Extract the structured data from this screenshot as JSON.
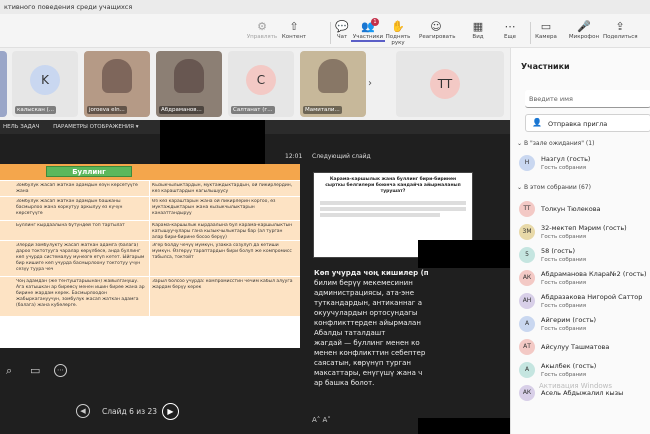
{
  "window": {
    "title": "ктивного поведения среди учащихся"
  },
  "toolbar": {
    "items": [
      {
        "label": "Управлять",
        "icon": "manage-icon",
        "glyph": "⚙",
        "disabled": true
      },
      {
        "label": "Контент",
        "icon": "share-icon",
        "glyph": "⇧",
        "disabled": false
      },
      {
        "label": "Чат",
        "icon": "chat-icon",
        "glyph": "💬",
        "disabled": false
      },
      {
        "label": "Участники",
        "icon": "people-icon",
        "glyph": "👥",
        "disabled": false,
        "badge": "1"
      },
      {
        "label": "Поднять руку",
        "icon": "raise-hand-icon",
        "glyph": "✋",
        "disabled": false
      },
      {
        "label": "Реагировать",
        "icon": "react-icon",
        "glyph": "☺",
        "disabled": false
      },
      {
        "label": "Вид",
        "icon": "view-icon",
        "glyph": "▦",
        "disabled": false
      },
      {
        "label": "Еще",
        "icon": "more-icon",
        "glyph": "⋯",
        "disabled": false
      },
      {
        "label": "Камера",
        "icon": "camera-icon",
        "glyph": "▭",
        "disabled": false
      },
      {
        "label": "Микрофон",
        "icon": "mic-icon",
        "glyph": "🎤",
        "disabled": false
      },
      {
        "label": "Поделиться",
        "icon": "share-screen-icon",
        "glyph": "⇪",
        "disabled": false
      }
    ]
  },
  "thumbs": [
    {
      "name": "калыскан (...",
      "initials": "K",
      "bg": "#c9d7f0",
      "kind": "avatar"
    },
    {
      "name": "joroeva eln...",
      "initials": "",
      "bg": "#b59a86",
      "kind": "video"
    },
    {
      "name": "Абдраманов...",
      "initials": "",
      "bg": "#8c7f74",
      "kind": "video"
    },
    {
      "name": "Салтанат (г...",
      "initials": "С",
      "bg": "#f3c9c5",
      "kind": "avatar"
    },
    {
      "name": "Мамитали...",
      "initials": "",
      "bg": "#c7b89a",
      "kind": "video"
    },
    {
      "name": "",
      "initials": "TT",
      "bg": "#f3c9c5",
      "kind": "big"
    }
  ],
  "presenter": {
    "bar_left": "НЕЛЬ ЗАДАЧ",
    "bar_display": "ПАРАМЕТРЫ ОТОБРАЖЕНИЯ ▾",
    "time": "12:01",
    "next_slide": "Следующий слайд",
    "slide_counter": "Слайд 6 из 23",
    "next_title": "Карама-каршылык жана буллинг бири-биринен сырткы белгилери боюнча кандайча айырмаланып турушат?",
    "notes": [
      "Көп учурда чоң кишилер (п",
      "билим берүү мекемесинин",
      "администрациясы, ата-эне",
      "туткандардын, антиканнаг а",
      "окуучулардын ортосундагы",
      "конфликттерден айырмалан",
      "Абалды таталдашт",
      "жагдай — буллинг менен ко",
      "менен конфликттин себептер",
      "саясатын, көрүнүп турган",
      "максаттары, енүгүшү жана ч",
      "ар башка болот."
    ]
  },
  "slide": {
    "header": "Буллинг",
    "rows": [
      {
        "left": "Зомбулук жасап жаткан адамдын өзүн көрсөтүүгө жана",
        "right": "Кызыкчылыктардын, муктаждыктардын, ой пикирлердин, көз караштардын кагылышуусу"
      },
      {
        "left": "Зомбулук жасап жаткан адамдын башканы басмырлоо жана коркутуу аркылуу өз күчүн көрсөтүүгө",
        "right": "Өз көз караштарын жана ой пикирлерин коргоо, өз муктаждыктарын жана кызыкчылыктарын канааттандыруу"
      },
      {
        "left": "Буллинг кырдаалына бүтүндөй топ тартылат",
        "right": "Карама-каршылык кырдаалына бул карама-каршылыктын катышуучулары гана кызыкчылыктары бар (ал турган алар бири-бирине босоо берүү)"
      },
      {
        "left": "Элерди зомбулукту жасап жаткан адамга (балага) дароо токтотууга чаралар көрүлбөсө, анда буллинг көп учурда системалуу мүнөзгө өтүп кетет. Ыйгарым бир кишиге көп учурда басмырлоону токтотуу үчүн сезүү туура чеч",
        "right": "Эгер болду чечүү мүмкүн, узакка созулуп да кетиши мүмкүн. Өзгөрүү тараптардын бири болуп же компромисс табылса, токтойт"
      },
      {
        "left": "Чоң адамдан (же тентуштарыынан) жайылганушу. Ага катышкан ар бирөөсү менен ишин бирөө жана ар бирине жардам керек. Басмырлоодон жабыркагануучун, зомбулук жасап жаткан адамга (балага) жана кубөлөргө.",
        "right": "Зарыл болсоо учурда: компромисстин чечим кабыл алууга жардам берүү керек"
      }
    ]
  },
  "panel": {
    "title": "Участники",
    "search_placeholder": "Введите имя",
    "invite": "Отправка пригла",
    "lobby_header": "В \"зале ожидания\" (1)",
    "in_meeting_header": "В этом собрании (67)",
    "lobby": [
      {
        "name": "Назгул (гость)",
        "sub": "Гость собрания",
        "initials": "Н",
        "bg": "#c9d7f0"
      }
    ],
    "people": [
      {
        "name": "Толкун Тюлекова",
        "sub": "",
        "initials": "TT",
        "bg": "#f3c9c5"
      },
      {
        "name": "32-мектеп Мэрим (гость)",
        "sub": "Гость собрания",
        "initials": "3М",
        "bg": "#e8d9a8"
      },
      {
        "name": "58 (гость)",
        "sub": "Гость собрания",
        "initials": "5",
        "bg": "#c5e5e0"
      },
      {
        "name": "Абдраманова Клара№2 (гость)",
        "sub": "Гость собрания",
        "initials": "АК",
        "bg": "#f3c9c5"
      },
      {
        "name": "Абдразакова Нигорой Саттор",
        "sub": "Гость собрания",
        "initials": "АН",
        "bg": "#d8cfe8"
      },
      {
        "name": "Айгерим (гость)",
        "sub": "Гость собрания",
        "initials": "А",
        "bg": "#c9d7f0"
      },
      {
        "name": "Айсулуу Ташматова",
        "sub": "",
        "initials": "АТ",
        "bg": "#f3c9c5"
      },
      {
        "name": "Акылбек (гость)",
        "sub": "Гость собрания",
        "initials": "А",
        "bg": "#c5e5e0"
      },
      {
        "name": "Асель Абдыжалил кызы",
        "sub": "",
        "initials": "АК",
        "bg": "#d8cfe8"
      }
    ],
    "watermark": "Активация Windows"
  }
}
